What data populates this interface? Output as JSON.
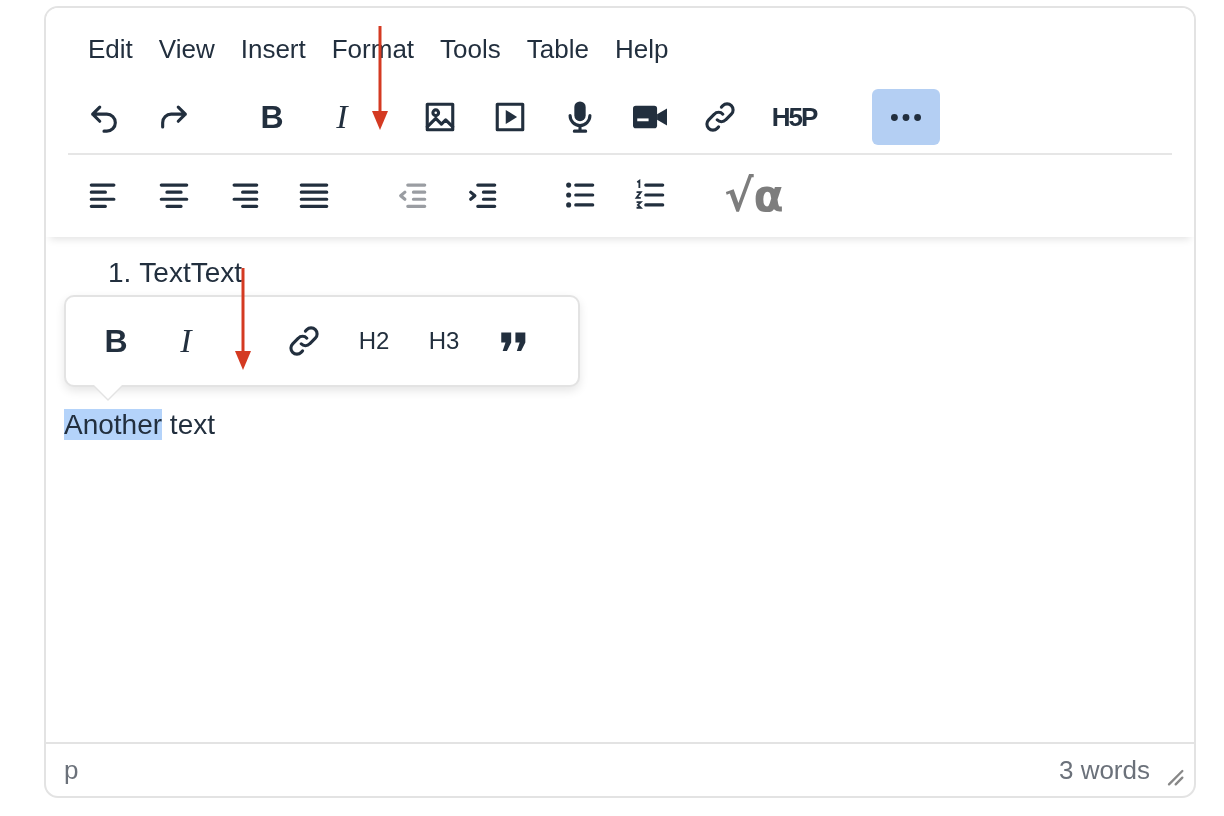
{
  "menubar": [
    "Edit",
    "View",
    "Insert",
    "Format",
    "Tools",
    "Table",
    "Help"
  ],
  "toolbar_row_1": [
    [
      {
        "kind": "undo",
        "selected": false
      },
      {
        "kind": "redo",
        "selected": false
      }
    ],
    [
      {
        "kind": "bold",
        "label": "B",
        "selected": false
      },
      {
        "kind": "italic",
        "label": "I",
        "selected": false
      }
    ],
    [
      {
        "kind": "image",
        "selected": false
      },
      {
        "kind": "media",
        "selected": false
      },
      {
        "kind": "mic",
        "selected": false
      },
      {
        "kind": "video",
        "selected": false
      },
      {
        "kind": "link",
        "selected": false
      },
      {
        "kind": "h5p",
        "label": "H5P",
        "selected": false
      }
    ],
    [
      {
        "kind": "more",
        "selected": true
      }
    ]
  ],
  "toolbar_row_2": [
    [
      {
        "kind": "align-left",
        "disabled": false
      },
      {
        "kind": "align-center",
        "disabled": false
      },
      {
        "kind": "align-right",
        "disabled": false
      },
      {
        "kind": "justify",
        "disabled": false
      }
    ],
    [
      {
        "kind": "outdent",
        "disabled": true
      },
      {
        "kind": "indent",
        "disabled": false
      }
    ],
    [
      {
        "kind": "bullets",
        "disabled": false
      },
      {
        "kind": "numbers",
        "disabled": false
      }
    ],
    [
      {
        "kind": "math",
        "label": "√α",
        "disabled": true
      }
    ]
  ],
  "content": {
    "list_item": {
      "number": "1.",
      "text": "TextText"
    },
    "paragraph": [
      {
        "text": "Another",
        "selected": true
      },
      {
        "text": " text",
        "selected": false
      }
    ]
  },
  "popup_toolbar": [
    [
      {
        "kind": "bold",
        "label": "B"
      },
      {
        "kind": "italic",
        "label": "I"
      }
    ],
    [
      {
        "kind": "link"
      },
      {
        "kind": "heading",
        "label": "H2"
      },
      {
        "kind": "heading",
        "label": "H3"
      },
      {
        "kind": "quote"
      }
    ]
  ],
  "annotation_arrows": [
    {
      "kind": "arrow"
    },
    {
      "kind": "arrow"
    }
  ],
  "status_bar": {
    "path": "p",
    "word_count": "3 words"
  }
}
